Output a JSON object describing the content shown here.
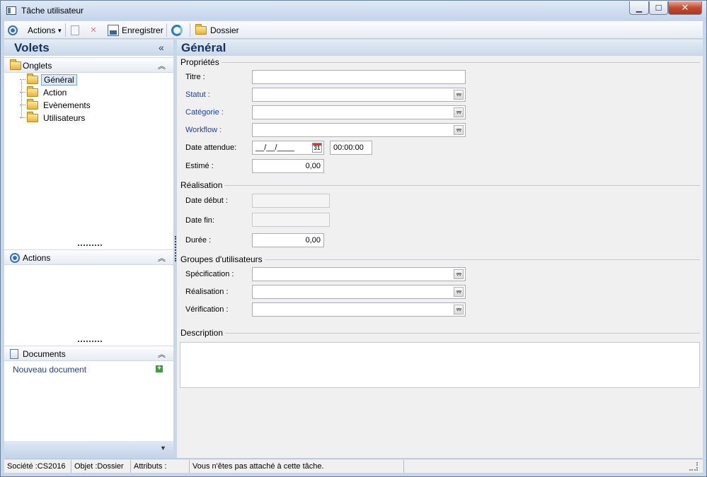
{
  "window": {
    "title": "Tâche utilisateur"
  },
  "toolbar": {
    "actions_label": "Actions",
    "save_label": "Enregistrer",
    "dossier_label": "Dossier"
  },
  "left": {
    "volets_title": "Volets",
    "onglets_title": "Onglets",
    "tree": [
      "Général",
      "Action",
      "Evènements",
      "Utilisateurs"
    ],
    "actions_title": "Actions",
    "documents_title": "Documents",
    "new_document": "Nouveau document"
  },
  "main": {
    "title": "Général",
    "groups": {
      "proprietes": "Propriétés",
      "realisation": "Réalisation",
      "groupes": "Groupes d'utilisateurs",
      "description": "Description"
    },
    "fields": {
      "titre": {
        "label": "Titre :",
        "value": ""
      },
      "statut": {
        "label": "Statut :",
        "value": ""
      },
      "categorie": {
        "label": "Catégorie :",
        "value": ""
      },
      "workflow": {
        "label": "Workflow :",
        "value": ""
      },
      "date_attendue": {
        "label": "Date attendue:",
        "value": "__/__/____",
        "time": "00:00:00",
        "cal": "31"
      },
      "estime": {
        "label": "Estimé :",
        "value": "0,00"
      },
      "date_debut": {
        "label": "Date début :",
        "value": ""
      },
      "date_fin": {
        "label": "Date fin:",
        "value": ""
      },
      "duree": {
        "label": "Durée :",
        "value": "0,00"
      },
      "specification": {
        "label": "Spécification :",
        "value": ""
      },
      "realisation_grp": {
        "label": "Réalisation :",
        "value": ""
      },
      "verification": {
        "label": "Vérification :",
        "value": ""
      }
    }
  },
  "status": {
    "societe": "Société :CS2016",
    "objet": "Objet :Dossier",
    "attributs": "Attributs :",
    "message": "Vous n'êtes pas attaché à cette tâche."
  }
}
